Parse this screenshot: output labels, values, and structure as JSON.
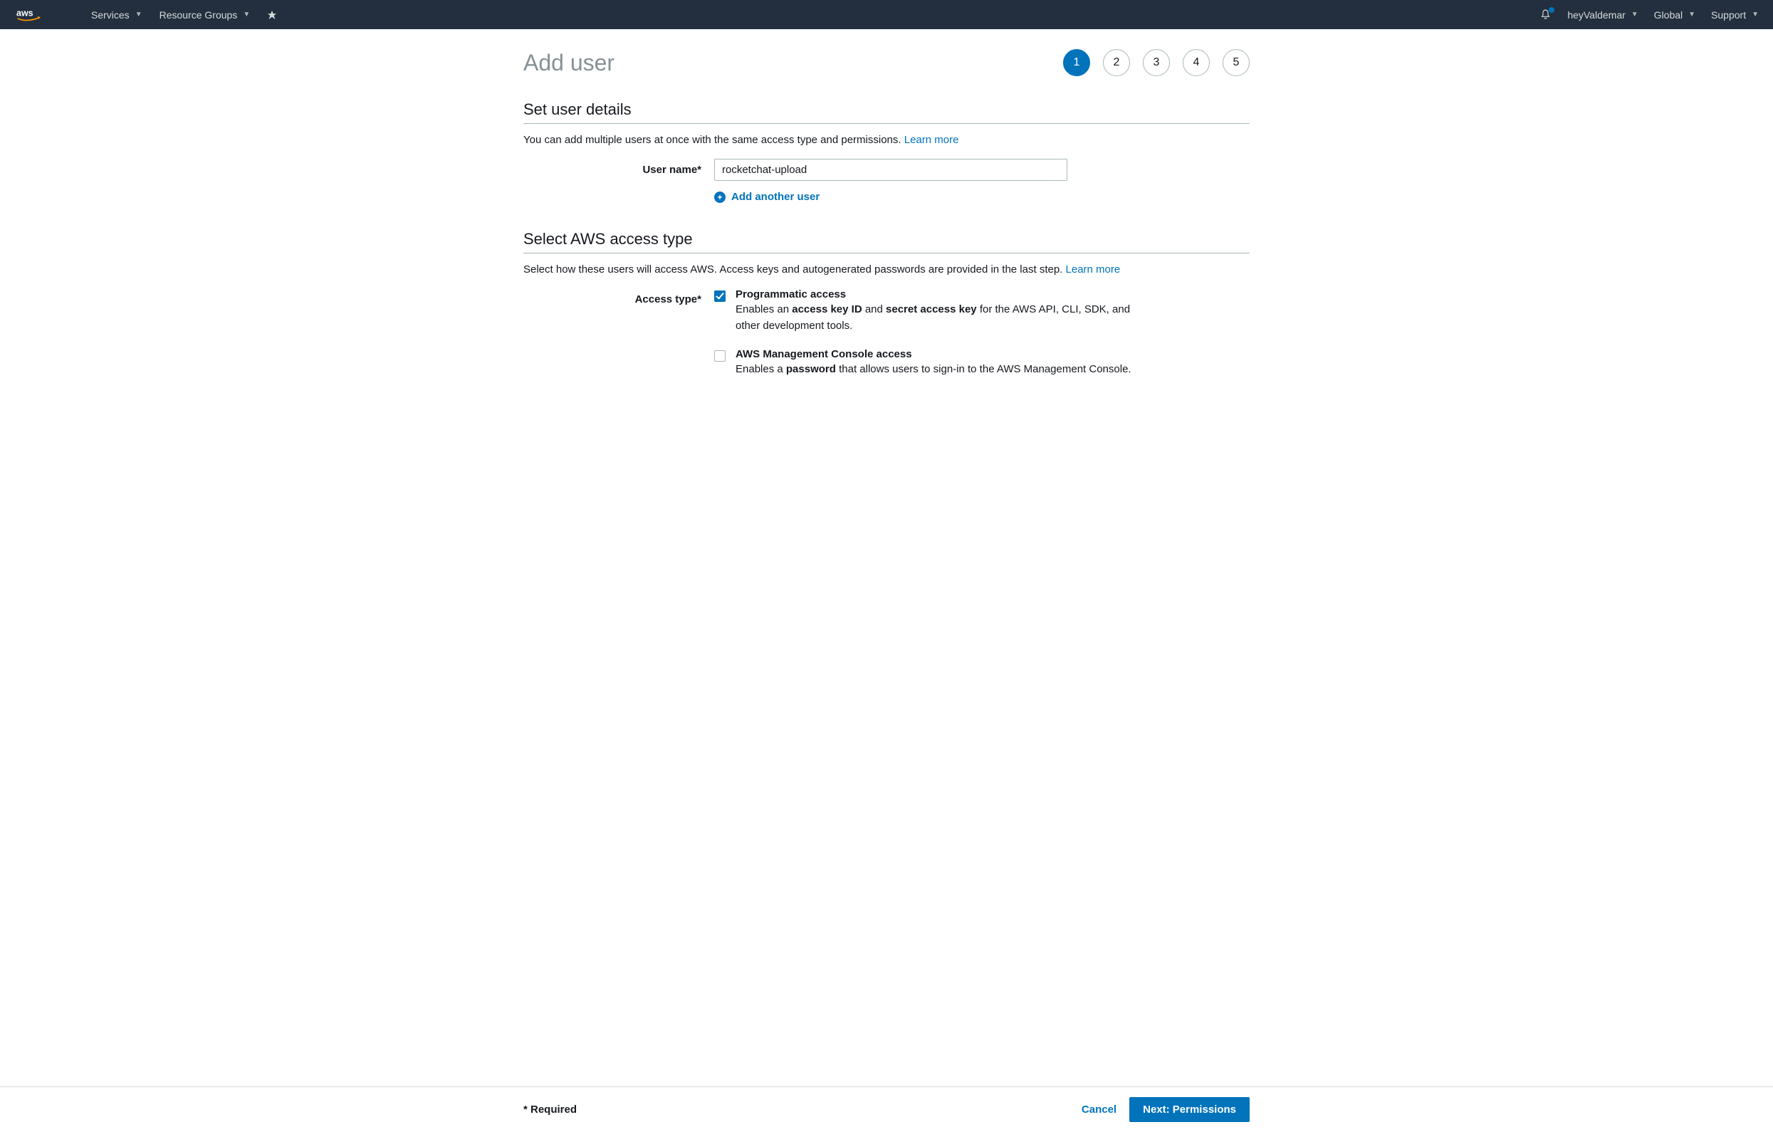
{
  "nav": {
    "services": "Services",
    "resource_groups": "Resource Groups",
    "account": "heyValdemar",
    "region": "Global",
    "support": "Support"
  },
  "page": {
    "title": "Add user"
  },
  "steps": [
    "1",
    "2",
    "3",
    "4",
    "5"
  ],
  "active_step": 1,
  "section_user_details": {
    "heading": "Set user details",
    "desc": "You can add multiple users at once with the same access type and permissions. ",
    "learn_more": "Learn more",
    "username_label": "User name*",
    "username_value": "rocketchat-upload",
    "add_another": "Add another user"
  },
  "section_access_type": {
    "heading": "Select AWS access type",
    "desc": "Select how these users will access AWS. Access keys and autogenerated passwords are provided in the last step. ",
    "learn_more": "Learn more",
    "label": "Access type*",
    "options": {
      "programmatic": {
        "checked": true,
        "title": "Programmatic access",
        "desc_pre": "Enables an ",
        "desc_b1": "access key ID",
        "desc_mid": " and ",
        "desc_b2": "secret access key",
        "desc_post": " for the AWS API, CLI, SDK, and other development tools."
      },
      "console": {
        "checked": false,
        "title": "AWS Management Console access",
        "desc_pre": "Enables a ",
        "desc_b1": "password",
        "desc_post": " that allows users to sign-in to the AWS Management Console."
      }
    }
  },
  "footer": {
    "required": "* Required",
    "cancel": "Cancel",
    "next": "Next: Permissions"
  }
}
